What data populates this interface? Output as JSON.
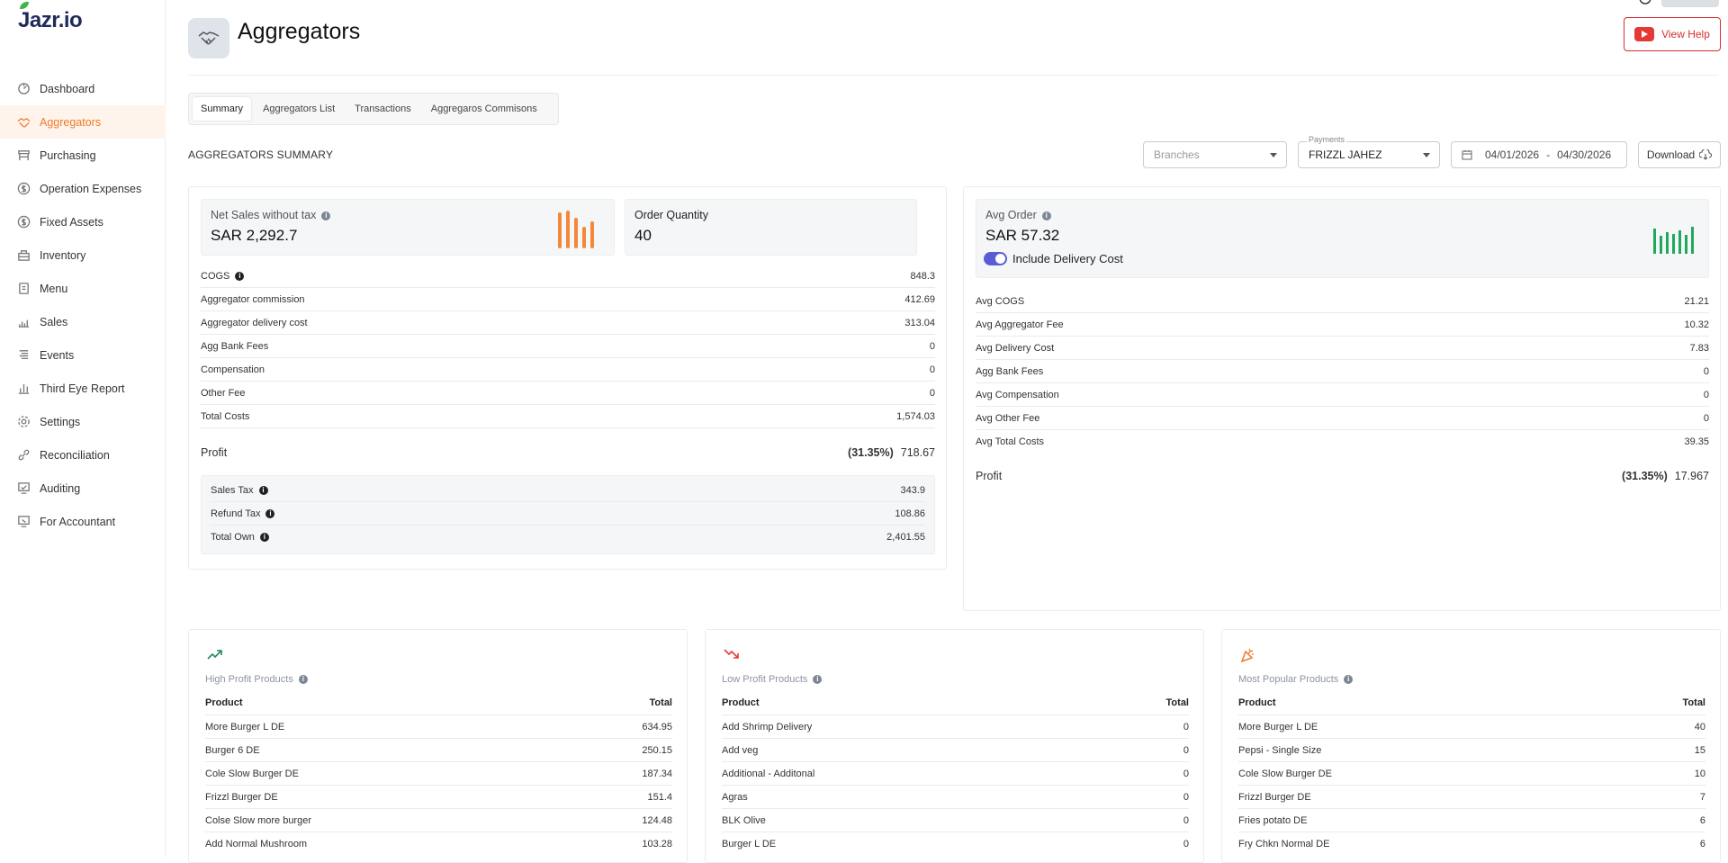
{
  "app": {
    "logo": "Jazr.io",
    "top_badge": "",
    "accent": "#f07a2a"
  },
  "sidebar": {
    "items": [
      {
        "label": "Dashboard",
        "icon": "dashboard-icon"
      },
      {
        "label": "Aggregators",
        "icon": "handshake-icon",
        "active": true
      },
      {
        "label": "Purchasing",
        "icon": "cart-icon"
      },
      {
        "label": "Operation Expenses",
        "icon": "dollar-icon"
      },
      {
        "label": "Fixed Assets",
        "icon": "dollar-icon"
      },
      {
        "label": "Inventory",
        "icon": "inventory-icon"
      },
      {
        "label": "Menu",
        "icon": "menu-icon"
      },
      {
        "label": "Sales",
        "icon": "sales-icon"
      },
      {
        "label": "Events",
        "icon": "events-icon"
      },
      {
        "label": "Third Eye Report",
        "icon": "report-icon"
      },
      {
        "label": "Settings",
        "icon": "gear-icon"
      },
      {
        "label": "Reconciliation",
        "icon": "link-icon"
      },
      {
        "label": "Auditing",
        "icon": "auditing-icon"
      },
      {
        "label": "For Accountant",
        "icon": "accountant-icon"
      }
    ]
  },
  "header": {
    "title": "Aggregators",
    "help_label": "View Help"
  },
  "tabs": [
    "Summary",
    "Aggregators List",
    "Transactions",
    "Aggregaros Commisons"
  ],
  "summary": {
    "title": "AGGREGATORS SUMMARY",
    "branches_placeholder": "Branches",
    "payments_label": "Payments",
    "payments_value": "FRIZZL JAHEZ",
    "date_from": "04/01/2026",
    "date_sep": "-",
    "date_to": "04/30/2026",
    "download_label": "Download"
  },
  "left": {
    "net_sales_label": "Net Sales without tax",
    "net_sales_value": "SAR 2,292.7",
    "order_qty_label": "Order Quantity",
    "order_qty_value": "40",
    "rows": [
      {
        "label": "COGS",
        "value": "848.3"
      },
      {
        "label": "Aggregator commission",
        "value": "412.69"
      },
      {
        "label": "Aggregator delivery cost",
        "value": "313.04"
      },
      {
        "label": "Agg Bank Fees",
        "value": "0"
      },
      {
        "label": "Compensation",
        "value": "0"
      },
      {
        "label": "Other Fee",
        "value": "0"
      },
      {
        "label": "Total Costs",
        "value": "1,574.03"
      }
    ],
    "profit_label": "Profit",
    "profit_pct": "(31.35%)",
    "profit_value": "718.67",
    "tax_rows": [
      {
        "label": "Sales Tax",
        "value": "343.9"
      },
      {
        "label": "Refund Tax",
        "value": "108.86"
      },
      {
        "label": "Total Own",
        "value": "2,401.55"
      }
    ]
  },
  "right": {
    "avg_order_label": "Avg Order",
    "avg_order_value": "SAR 57.32",
    "include_delivery_label": "Include Delivery Cost",
    "rows": [
      {
        "label": "Avg COGS",
        "value": "21.21"
      },
      {
        "label": "Avg Aggregator Fee",
        "value": "10.32"
      },
      {
        "label": "Avg Delivery Cost",
        "value": "7.83"
      },
      {
        "label": "Agg Bank Fees",
        "value": "0"
      },
      {
        "label": "Avg Compensation",
        "value": "0"
      },
      {
        "label": "Avg Other Fee",
        "value": "0"
      },
      {
        "label": "Avg Total Costs",
        "value": "39.35"
      }
    ],
    "profit_label": "Profit",
    "profit_pct": "(31.35%)",
    "profit_value": "17.967"
  },
  "products": [
    {
      "title": "High Profit Products",
      "icon": "trend-up-icon",
      "color": "#1f8a5b",
      "col1": "Product",
      "col2": "Total",
      "rows": [
        [
          "More Burger L DE",
          "634.95"
        ],
        [
          "Burger 6 DE",
          "250.15"
        ],
        [
          "Cole Slow Burger DE",
          "187.34"
        ],
        [
          "Frizzl Burger DE",
          "151.4"
        ],
        [
          "Colse Slow more burger",
          "124.48"
        ],
        [
          "Add Normal Mushroom",
          "103.28"
        ]
      ]
    },
    {
      "title": "Low Profit Products",
      "icon": "trend-down-icon",
      "color": "#e53935",
      "col1": "Product",
      "col2": "Total",
      "rows": [
        [
          "Add Shrimp Delivery",
          "0"
        ],
        [
          "Add veg",
          "0"
        ],
        [
          "Additional - Additonal",
          "0"
        ],
        [
          "Agras",
          "0"
        ],
        [
          "BLK Olive",
          "0"
        ],
        [
          "Burger L DE",
          "0"
        ]
      ]
    },
    {
      "title": "Most Popular Products",
      "icon": "party-icon",
      "color": "#f07a2a",
      "col1": "Product",
      "col2": "Total",
      "rows": [
        [
          "More Burger L DE",
          "40"
        ],
        [
          "Pepsi - Single Size",
          "15"
        ],
        [
          "Cole Slow Burger DE",
          "10"
        ],
        [
          "Frizzl Burger DE",
          "7"
        ],
        [
          "Fries potato DE",
          "6"
        ],
        [
          "Fry Chkn Normal DE",
          "6"
        ]
      ]
    }
  ]
}
